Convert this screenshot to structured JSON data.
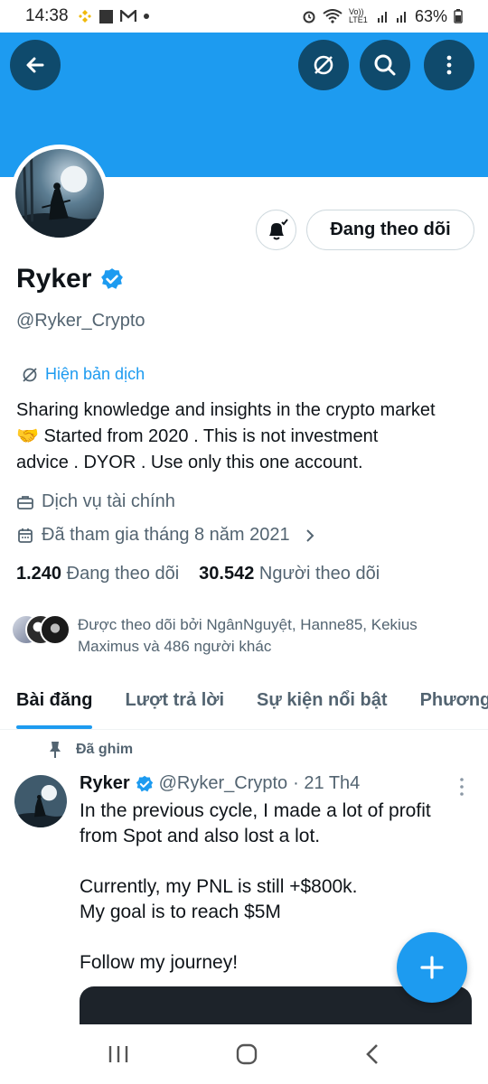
{
  "status_bar": {
    "time": "14:38",
    "battery": "63%",
    "network": "Vo)) LTE1"
  },
  "header": {
    "back_icon": "arrow-left-icon",
    "translate_icon": "translate-off-icon",
    "search_icon": "search-icon",
    "more_icon": "more-vertical-icon",
    "banner_color": "#1d9bf0"
  },
  "profile": {
    "name": "Ryker",
    "handle": "@Ryker_Crypto",
    "show_translation": "Hiện bản dịch",
    "bio_lines": [
      "Sharing knowledge and insights in the crypto market",
      "🤝 Started from 2020 . This is not investment",
      "advice . DYOR . Use only this one account."
    ],
    "category": "Dịch vụ tài chính",
    "joined": "Đã tham gia tháng 8 năm 2021",
    "following_count": "1.240",
    "following_label": "Đang theo dõi",
    "followers_count": "30.542",
    "followers_label": "Người theo dõi",
    "followed_by": "Được theo dõi bởi NgânNguyệt, Hanne85, Kekius Maximus và 486 người khác",
    "follow_button": "Đang theo dõi"
  },
  "tabs": [
    {
      "label": "Bài đăng",
      "active": true
    },
    {
      "label": "Lượt trả lời",
      "active": false
    },
    {
      "label": "Sự kiện nổi bật",
      "active": false
    },
    {
      "label": "Phương",
      "active": false
    }
  ],
  "post": {
    "pinned_label": "Đã ghim",
    "author": "Ryker",
    "handle": "@Ryker_Crypto",
    "date": "· 21 Th4",
    "lines": [
      "In the previous cycle, I made a lot of profit",
      "from Spot and also lost a lot.",
      "",
      "Currently, my PNL is still +$800k.",
      "My goal is to reach $5M",
      "",
      "Follow my journey!"
    ]
  },
  "colors": {
    "accent": "#1d9bf0",
    "text": "#0f1419",
    "muted": "#536471"
  }
}
